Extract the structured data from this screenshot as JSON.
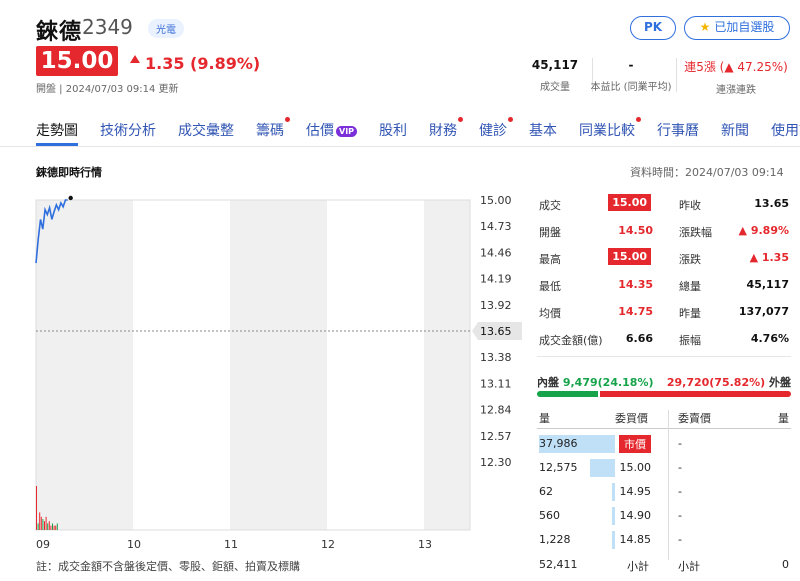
{
  "header": {
    "name": "錸德",
    "code": "2349",
    "sector": "光電",
    "pk_label": "PK",
    "watch_label": "已加自選股",
    "price": "15.00",
    "change": "1.35 (9.89%)",
    "meta": "開盤 | 2024/07/03 09:14 更新",
    "stats": [
      {
        "value": "45,117",
        "label": "成交量"
      },
      {
        "value": "-",
        "label": "本益比 (同業平均)"
      },
      {
        "value": "連5漲 (▲ 47.25%)",
        "label": "連漲連跌"
      }
    ]
  },
  "tabs": [
    {
      "label": "走勢圖",
      "active": true,
      "dot": false,
      "vip": false
    },
    {
      "label": "技術分析",
      "active": false,
      "dot": false,
      "vip": false
    },
    {
      "label": "成交彙整",
      "active": false,
      "dot": false,
      "vip": false
    },
    {
      "label": "籌碼",
      "active": false,
      "dot": true,
      "vip": false
    },
    {
      "label": "估價",
      "active": false,
      "dot": false,
      "vip": true
    },
    {
      "label": "股利",
      "active": false,
      "dot": false,
      "vip": false
    },
    {
      "label": "財務",
      "active": false,
      "dot": true,
      "vip": false
    },
    {
      "label": "健診",
      "active": false,
      "dot": true,
      "vip": false
    },
    {
      "label": "基本",
      "active": false,
      "dot": false,
      "vip": false
    },
    {
      "label": "同業比較",
      "active": false,
      "dot": true,
      "vip": false
    },
    {
      "label": "行事曆",
      "active": false,
      "dot": false,
      "vip": false
    },
    {
      "label": "新聞",
      "active": false,
      "dot": false,
      "vip": false
    },
    {
      "label": "使用說明",
      "active": false,
      "dot": false,
      "vip": false
    }
  ],
  "vip_badge": "VIP",
  "section": {
    "title": "錸德即時行情",
    "data_time": "資料時間：2024/07/03 09:14"
  },
  "chart_data": {
    "type": "line",
    "x_ticks": [
      "09",
      "10",
      "11",
      "12",
      "13"
    ],
    "y_ticks": [
      "15.00",
      "14.73",
      "14.46",
      "14.19",
      "13.92",
      "13.65",
      "13.38",
      "13.11",
      "12.84",
      "12.57",
      "12.30"
    ],
    "ylim": [
      12.3,
      15.0
    ],
    "reference_price": "13.65",
    "price_series_minutes": [
      0,
      1,
      2,
      3,
      4,
      5,
      6,
      7,
      8,
      9,
      10,
      11,
      12,
      13,
      14
    ],
    "price_series": [
      14.35,
      14.6,
      14.8,
      14.7,
      14.9,
      14.85,
      14.92,
      14.8,
      14.88,
      14.95,
      14.9,
      14.97,
      14.93,
      15.0,
      15.0
    ],
    "volume_bars": [
      20,
      3,
      8,
      6,
      5,
      4,
      6,
      3,
      4,
      2,
      3,
      2,
      2,
      3
    ],
    "footnote": "註：成交金額不含盤後定價、零股、鉅額、拍賣及標購"
  },
  "quote": {
    "rows": [
      {
        "l1": "成交",
        "v1": "15.00",
        "v1box": true,
        "v1color": "#fff",
        "l2": "昨收",
        "v2": "13.65",
        "v2color": "#111"
      },
      {
        "l1": "開盤",
        "v1": "14.50",
        "v1box": false,
        "v1color": "#e5282d",
        "l2": "漲跌幅",
        "v2": "▲ 9.89%",
        "v2color": "#e5282d"
      },
      {
        "l1": "最高",
        "v1": "15.00",
        "v1box": true,
        "v1color": "#fff",
        "l2": "漲跌",
        "v2": "▲ 1.35",
        "v2color": "#e5282d"
      },
      {
        "l1": "最低",
        "v1": "14.35",
        "v1box": false,
        "v1color": "#e5282d",
        "l2": "總量",
        "v2": "45,117",
        "v2color": "#111"
      },
      {
        "l1": "均價",
        "v1": "14.75",
        "v1box": false,
        "v1color": "#e5282d",
        "l2": "昨量",
        "v2": "137,077",
        "v2color": "#111"
      },
      {
        "l1": "成交金額(億)",
        "v1": "6.66",
        "v1box": false,
        "v1color": "#111",
        "l2": "振幅",
        "v2": "4.76%",
        "v2color": "#111"
      }
    ],
    "inner_label": "內盤",
    "inner_value": "9,479",
    "inner_pct": "(24.18%)",
    "outer_value": "29,720",
    "outer_pct": "(75.82%)",
    "outer_label": "外盤",
    "inner_fraction": 0.2418
  },
  "orderbook": {
    "headers": [
      "量",
      "委買價",
      "委賣價",
      "量"
    ],
    "rows": [
      {
        "vol": "37,986",
        "bid": "市價",
        "market": true,
        "bar_fraction": 1.0,
        "ask": "-",
        "askvol": ""
      },
      {
        "vol": "12,575",
        "bid": "15.00",
        "market": false,
        "bar_fraction": 0.33,
        "ask": "-",
        "askvol": ""
      },
      {
        "vol": "62",
        "bid": "14.95",
        "market": false,
        "bar_fraction": 0.02,
        "ask": "-",
        "askvol": ""
      },
      {
        "vol": "560",
        "bid": "14.90",
        "market": false,
        "bar_fraction": 0.03,
        "ask": "-",
        "askvol": ""
      },
      {
        "vol": "1,228",
        "bid": "14.85",
        "market": false,
        "bar_fraction": 0.04,
        "ask": "-",
        "askvol": ""
      }
    ],
    "footer": {
      "total_bid": "52,411",
      "bid_label": "小計",
      "ask_label": "小計",
      "total_ask": "0"
    }
  }
}
